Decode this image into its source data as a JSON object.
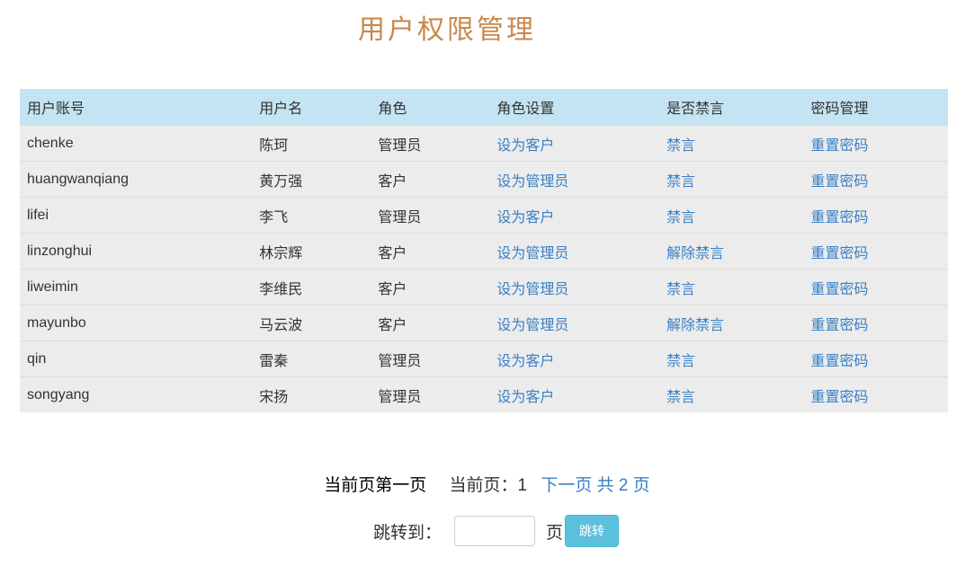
{
  "title": "用户权限管理",
  "columns": [
    "用户账号",
    "用户名",
    "角色",
    "角色设置",
    "是否禁言",
    "密码管理"
  ],
  "rows": [
    [
      "chenke",
      "陈珂",
      "管理员",
      "设为客户",
      "禁言",
      "重置密码"
    ],
    [
      "huangwanqiang",
      "黄万强",
      "客户",
      "设为管理员",
      "禁言",
      "重置密码"
    ],
    [
      "lifei",
      "李飞",
      "管理员",
      "设为客户",
      "禁言",
      "重置密码"
    ],
    [
      "linzonghui",
      "林宗辉",
      "客户",
      "设为管理员",
      "解除禁言",
      "重置密码"
    ],
    [
      "liweimin",
      "李维民",
      "客户",
      "设为管理员",
      "禁言",
      "重置密码"
    ],
    [
      "mayunbo",
      "马云波",
      "客户",
      "设为管理员",
      "解除禁言",
      "重置密码"
    ],
    [
      "qin",
      "雷秦",
      "管理员",
      "设为客户",
      "禁言",
      "重置密码"
    ],
    [
      "songyang",
      "宋扬",
      "管理员",
      "设为客户",
      "禁言",
      "重置密码"
    ]
  ],
  "pager": {
    "first": "当前页第一页",
    "current": "当前页：1",
    "next": "下一页",
    "total": "共 2 页"
  },
  "jump": {
    "label": "跳转到：",
    "value": "",
    "unit": "页",
    "button": "跳转"
  }
}
